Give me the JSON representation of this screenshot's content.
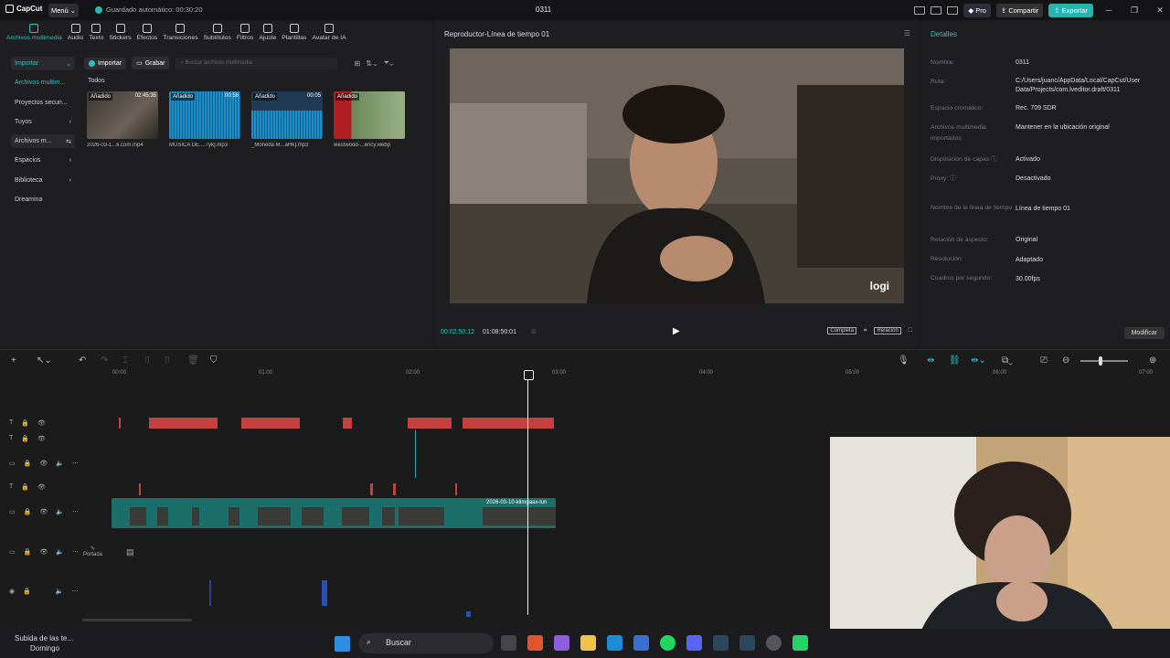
{
  "titlebar": {
    "app_name": "CapCut",
    "menu_label": "Menú",
    "autosave": "Guardado automático: 00:30:20",
    "project_title": "0311",
    "pro_label": "Pro",
    "share_label": "Compartir",
    "export_label": "Exportar"
  },
  "toolbar_tabs": [
    {
      "label": "Archivos multimedia",
      "icon": "media-icon"
    },
    {
      "label": "Audio",
      "icon": "audio-icon"
    },
    {
      "label": "Texto",
      "icon": "text-icon"
    },
    {
      "label": "Stickers",
      "icon": "sticker-icon"
    },
    {
      "label": "Efectos",
      "icon": "effects-icon"
    },
    {
      "label": "Transiciones",
      "icon": "transition-icon"
    },
    {
      "label": "Subtítulos",
      "icon": "subtitles-icon"
    },
    {
      "label": "Filtros",
      "icon": "filter-icon"
    },
    {
      "label": "Ajuste",
      "icon": "adjust-icon"
    },
    {
      "label": "Plantillas",
      "icon": "templates-icon"
    },
    {
      "label": "Avatar de IA",
      "icon": "avatar-icon"
    }
  ],
  "sidenav": [
    {
      "label": "Importar",
      "chev": "⌄"
    },
    {
      "label": "Archivos multim...",
      "chev": ""
    },
    {
      "label": "Proyectos secun...",
      "chev": ""
    },
    {
      "label": "Tuyos",
      "chev": "›"
    },
    {
      "label": "Archivos m...",
      "chev": "⇆"
    },
    {
      "label": "Espacios",
      "chev": "›"
    },
    {
      "label": "Biblioteca",
      "chev": "›"
    },
    {
      "label": "Dreamina",
      "chev": ""
    }
  ],
  "media_bar": {
    "import_label": "Importar",
    "record_label": "Grabar",
    "search_placeholder": "Buscar archivos multimedia"
  },
  "all_label": "Todos",
  "media_items": [
    {
      "badge": "Añadido",
      "duration": "02:45:35",
      "caption": "2026-03-1...k.com.mp4",
      "kind": "video"
    },
    {
      "badge": "Añadido",
      "duration": "00:56",
      "caption": "MUSICA DE....7yk].mp3",
      "kind": "audio"
    },
    {
      "badge": "Añadido",
      "duration": "00:05",
      "caption": "_Moneda M...aHk].mp3",
      "kind": "audio"
    },
    {
      "badge": "Añadido",
      "duration": "",
      "caption": "westwood-...ency.webp",
      "kind": "image"
    }
  ],
  "player": {
    "title": "Reproductor-Línea de tiempo 01",
    "current_time": "00:02:50:12",
    "total_time": "01:08:50:01",
    "full_label": "Completa",
    "ratio_label": "Relación",
    "watermark": "logi"
  },
  "details": {
    "title": "Detalles",
    "rows": [
      {
        "label": "Nombre:",
        "value": "0311"
      },
      {
        "label": "Ruta:",
        "value": "C:/Users/juanc/AppData/Local/CapCut/User Data/Projects/com.lveditor.draft/0311"
      },
      {
        "label": "Espacio cromático:",
        "value": "Rec. 709 SDR"
      },
      {
        "label": "Archivos multimedia importados:",
        "value": "Mantener en la ubicación original"
      },
      {
        "label": "Disposición de capas ⓘ",
        "value": "Activado"
      },
      {
        "label": "Proxy: ⓘ",
        "value": "Desactivado"
      },
      {
        "label": "Nombre de la línea de tiempo",
        "value": "Línea de tiempo 01"
      },
      {
        "label": "Relación de aspecto:",
        "value": "Original"
      },
      {
        "label": "Resolución:",
        "value": "Adaptado"
      },
      {
        "label": "Cuadros por segundo:",
        "value": "30.00fps"
      }
    ],
    "modify_label": "Modificar"
  },
  "timeline": {
    "ruler": [
      "00:00",
      "01:00",
      "02:00",
      "03:00",
      "04:00",
      "05:00",
      "06:00",
      "07:00"
    ],
    "clip_label": "2026-03-10-kilmgaax-lun",
    "cover_label": "Portada"
  },
  "taskbar": {
    "notif_title": "Subida de las te...",
    "notif_sub": "Domingo",
    "search_label": "Buscar"
  }
}
